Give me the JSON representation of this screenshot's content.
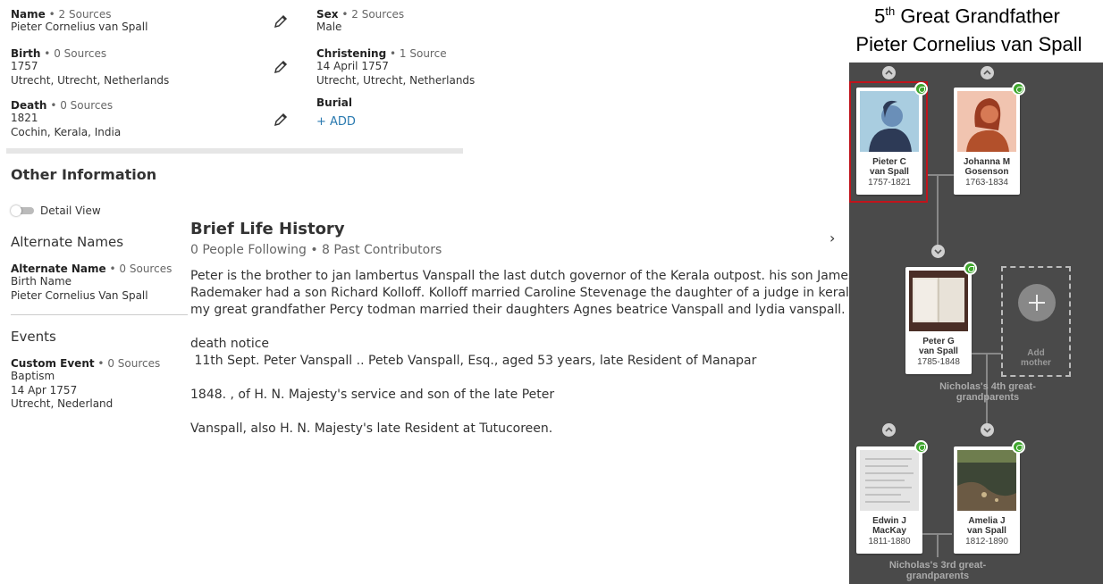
{
  "vitals": {
    "name": {
      "label": "Name",
      "sources": "2 Sources",
      "value": "Pieter Cornelius van Spall"
    },
    "sex": {
      "label": "Sex",
      "sources": "2 Sources",
      "value": "Male"
    },
    "birth": {
      "label": "Birth",
      "sources": "0 Sources",
      "date": "1757",
      "place": "Utrecht, Utrecht, Netherlands"
    },
    "christening": {
      "label": "Christening",
      "sources": "1 Source",
      "date": "14 April 1757",
      "place": "Utrecht, Utrecht, Netherlands"
    },
    "death": {
      "label": "Death",
      "sources": "0 Sources",
      "date": "1821",
      "place": "Cochin, Kerala, India"
    },
    "burial": {
      "label": "Burial",
      "add": "+  ADD"
    }
  },
  "other_info": {
    "heading": "Other Information",
    "detail_view": "Detail View",
    "alt_names_heading": "Alternate Names",
    "alt_name": {
      "label": "Alternate Name",
      "sources": "0 Sources",
      "type": "Birth Name",
      "value": "Pieter Cornelius Van Spall"
    },
    "events_heading": "Events",
    "event": {
      "label": "Custom Event",
      "sources": "0 Sources",
      "type": "Baptism",
      "date": "14 Apr 1757",
      "place": "Utrecht, Nederland"
    }
  },
  "life_history": {
    "title": "Brief Life History",
    "meta": "0 People Following • 8 Past Contributors",
    "lines": [
      "Peter is the brother to jan lambertus Vanspall the last dutch governor of the Kerala outpost. his son James",
      "Rademaker had a son Richard Kolloff.  Kolloff married Caroline Stevenage the daughter of a  judge in kerala and",
      "my great grandfather Percy todman married their daughters Agnes beatrice Vanspall and lydia vanspall.",
      "",
      "death notice",
      " 11th Sept. Peter Vanspall .. Peteb Vanspall, Esq., aged 53 years, late Resident of Manapar",
      "",
      "1848. , of H. N. Majesty's service and son of the late Peter",
      "",
      "Vanspall, also H. N. Majesty's late Resident at Tutucoreen."
    ],
    "close_glyph": "›"
  },
  "tree": {
    "heading_line1_num": "5",
    "heading_line1_sup": "th",
    "heading_line1_rest": " Great Grandfather",
    "heading_line2": "Pieter Cornelius van Spall",
    "cards": [
      {
        "name1": "Pieter C",
        "name2": "van Spall",
        "years": "1757-1821"
      },
      {
        "name1": "Johanna M",
        "name2": "Gosenson",
        "years": "1763-1834"
      },
      {
        "name1": "Peter G",
        "name2": "van Spall",
        "years": "1785-1848"
      },
      {
        "name1": "Edwin J",
        "name2": "MacKay",
        "years": "1811-1880"
      },
      {
        "name1": "Amelia J",
        "name2": "van Spall",
        "years": "1812-1890"
      }
    ],
    "add_mother": "Add\nmother",
    "caption_4th": "Nicholas's 4th great-\ngrandparents",
    "caption_3rd": "Nicholas's 3rd great-\ngrandparents",
    "colors": {
      "highlight": "#c0141c",
      "male_bg": "#a9cde0",
      "female_bg": "#f1c4b0",
      "leaf": "#3fa62e"
    }
  }
}
